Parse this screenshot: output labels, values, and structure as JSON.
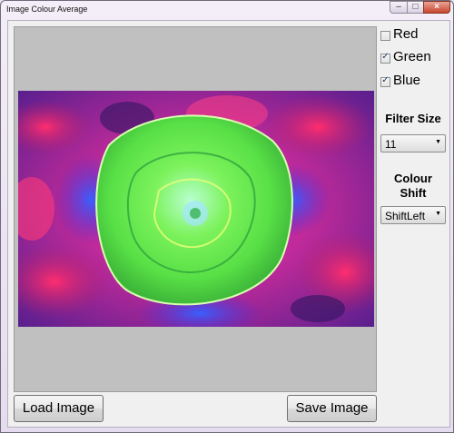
{
  "window": {
    "title": "Image Colour Average"
  },
  "buttons": {
    "load": "Load Image",
    "save": "Save Image"
  },
  "channels": [
    {
      "label": "Red",
      "checked": false
    },
    {
      "label": "Green",
      "checked": true
    },
    {
      "label": "Blue",
      "checked": true
    }
  ],
  "filter_size": {
    "label": "Filter Size",
    "selected": "11"
  },
  "colour_shift": {
    "label_line1": "Colour",
    "label_line2": "Shift",
    "selected": "ShiftLeft"
  },
  "colors": {
    "accent_magenta": "#d81f8a",
    "accent_purple": "#6e2bd9",
    "rose_green": "#6ef05a"
  }
}
